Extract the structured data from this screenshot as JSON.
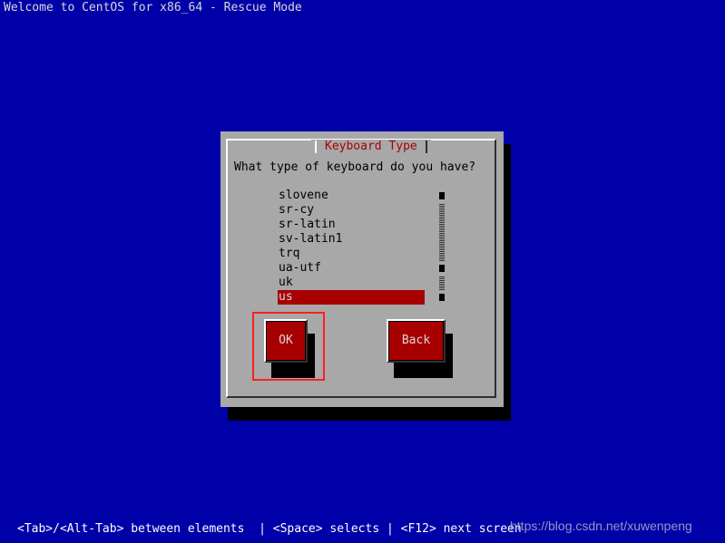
{
  "window": {
    "title": "Welcome to CentOS for x86_64 - Rescue Mode"
  },
  "dialog": {
    "title": "Keyboard Type",
    "question": "What type of keyboard do you have?",
    "items": [
      {
        "label": "slovene",
        "selected": false
      },
      {
        "label": "sr-cy",
        "selected": false
      },
      {
        "label": "sr-latin",
        "selected": false
      },
      {
        "label": "sv-latin1",
        "selected": false
      },
      {
        "label": "trq",
        "selected": false
      },
      {
        "label": "ua-utf",
        "selected": false
      },
      {
        "label": "uk",
        "selected": false
      },
      {
        "label": "us",
        "selected": true
      }
    ],
    "buttons": {
      "ok_label": "OK",
      "back_label": "Back"
    }
  },
  "footer": {
    "help": "<Tab>/<Alt-Tab> between elements  | <Space> selects | <F12> next screen",
    "watermark": "https://blog.csdn.net/xuwenpeng"
  },
  "colors": {
    "background": "#0000a8",
    "dialog": "#a8a8a8",
    "accent": "#a80000",
    "highlight_box": "#ff2020"
  }
}
